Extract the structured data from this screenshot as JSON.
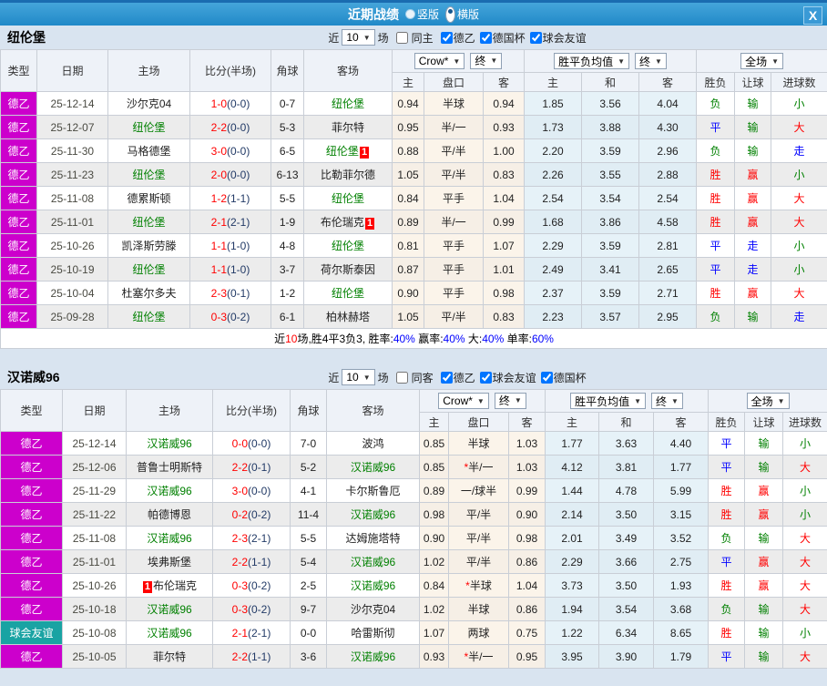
{
  "titlebar": {
    "title": "近期战绩",
    "radios": [
      {
        "label": "竖版",
        "selected": false
      },
      {
        "label": "横版",
        "selected": true
      }
    ],
    "close_label": "X"
  },
  "result_colors": {
    "胜": "r",
    "赢": "r",
    "大": "r",
    "平": "b",
    "走": "b",
    "负": "g",
    "输": "g",
    "小": "g"
  },
  "palette": {
    "league_badge_bg": "#cc00cc",
    "friendly_badge_bg": "#19a3a3",
    "team_highlight": "#008000",
    "score": "#ff0000",
    "win_red": "#ff0000",
    "draw_blue": "#0000ff",
    "lose_green": "#008000"
  },
  "tables": [
    {
      "team": "纽伦堡",
      "filter": {
        "near": "近",
        "count": "10",
        "unit": "场",
        "same": {
          "label": "同主",
          "checked": false
        },
        "leagues": [
          {
            "label": "德乙",
            "checked": true
          },
          {
            "label": "德国杯",
            "checked": true
          },
          {
            "label": "球会友谊",
            "checked": true
          }
        ]
      },
      "columns": {
        "type": "类型",
        "date": "日期",
        "home": "主场",
        "score": "比分(半场)",
        "corner": "角球",
        "away": "客场"
      },
      "selects": {
        "company": "Crow*",
        "final1": "终",
        "avg": "胜平负均值",
        "final2": "终",
        "scope": "全场"
      },
      "subheaders": [
        "主",
        "盘口",
        "客",
        "主",
        "和",
        "客",
        "胜负",
        "让球",
        "进球数"
      ],
      "rows": [
        {
          "type": "德乙",
          "tkey": "league",
          "date": "25-12-14",
          "home": {
            "name": "沙尔克04",
            "green": false
          },
          "score": "1-0",
          "half": "(0-0)",
          "corner": "0-7",
          "away": {
            "name": "纽伦堡",
            "green": true
          },
          "odds": [
            "0.94",
            "半球",
            "0.94",
            "1.85",
            "3.56",
            "4.04"
          ],
          "res": [
            "负",
            "输",
            "小"
          ]
        },
        {
          "type": "德乙",
          "tkey": "league",
          "date": "25-12-07",
          "home": {
            "name": "纽伦堡",
            "green": true
          },
          "score": "2-2",
          "half": "(0-0)",
          "corner": "5-3",
          "away": {
            "name": "菲尔特",
            "green": false
          },
          "odds": [
            "0.95",
            "半/一",
            "0.93",
            "1.73",
            "3.88",
            "4.30"
          ],
          "res": [
            "平",
            "输",
            "大"
          ]
        },
        {
          "type": "德乙",
          "tkey": "league",
          "date": "25-11-30",
          "home": {
            "name": "马格德堡",
            "green": false
          },
          "score": "3-0",
          "half": "(0-0)",
          "corner": "6-5",
          "away": {
            "name": "纽伦堡",
            "green": true,
            "badge": "1",
            "badge_side": "right"
          },
          "odds": [
            "0.88",
            "平/半",
            "1.00",
            "2.20",
            "3.59",
            "2.96"
          ],
          "res": [
            "负",
            "输",
            "走"
          ]
        },
        {
          "type": "德乙",
          "tkey": "league",
          "date": "25-11-23",
          "home": {
            "name": "纽伦堡",
            "green": true
          },
          "score": "2-0",
          "half": "(0-0)",
          "corner": "6-13",
          "away": {
            "name": "比勒菲尔德",
            "green": false
          },
          "odds": [
            "1.05",
            "平/半",
            "0.83",
            "2.26",
            "3.55",
            "2.88"
          ],
          "res": [
            "胜",
            "赢",
            "小"
          ]
        },
        {
          "type": "德乙",
          "tkey": "league",
          "date": "25-11-08",
          "home": {
            "name": "德累斯顿",
            "green": false
          },
          "score": "1-2",
          "half": "(1-1)",
          "corner": "5-5",
          "away": {
            "name": "纽伦堡",
            "green": true
          },
          "odds": [
            "0.84",
            "平手",
            "1.04",
            "2.54",
            "3.54",
            "2.54"
          ],
          "res": [
            "胜",
            "赢",
            "大"
          ]
        },
        {
          "type": "德乙",
          "tkey": "league",
          "date": "25-11-01",
          "home": {
            "name": "纽伦堡",
            "green": true
          },
          "score": "2-1",
          "half": "(2-1)",
          "corner": "1-9",
          "away": {
            "name": "布伦瑞克",
            "green": false,
            "badge": "1",
            "badge_side": "right"
          },
          "odds": [
            "0.89",
            "半/一",
            "0.99",
            "1.68",
            "3.86",
            "4.58"
          ],
          "res": [
            "胜",
            "赢",
            "大"
          ]
        },
        {
          "type": "德乙",
          "tkey": "league",
          "date": "25-10-26",
          "home": {
            "name": "凯泽斯劳滕",
            "green": false
          },
          "score": "1-1",
          "half": "(1-0)",
          "corner": "4-8",
          "away": {
            "name": "纽伦堡",
            "green": true
          },
          "odds": [
            "0.81",
            "平手",
            "1.07",
            "2.29",
            "3.59",
            "2.81"
          ],
          "res": [
            "平",
            "走",
            "小"
          ]
        },
        {
          "type": "德乙",
          "tkey": "league",
          "date": "25-10-19",
          "home": {
            "name": "纽伦堡",
            "green": true
          },
          "score": "1-1",
          "half": "(1-0)",
          "corner": "3-7",
          "away": {
            "name": "荷尔斯泰因",
            "green": false
          },
          "odds": [
            "0.87",
            "平手",
            "1.01",
            "2.49",
            "3.41",
            "2.65"
          ],
          "res": [
            "平",
            "走",
            "小"
          ]
        },
        {
          "type": "德乙",
          "tkey": "league",
          "date": "25-10-04",
          "home": {
            "name": "杜塞尔多夫",
            "green": false
          },
          "score": "2-3",
          "half": "(0-1)",
          "corner": "1-2",
          "away": {
            "name": "纽伦堡",
            "green": true
          },
          "odds": [
            "0.90",
            "平手",
            "0.98",
            "2.37",
            "3.59",
            "2.71"
          ],
          "res": [
            "胜",
            "赢",
            "大"
          ]
        },
        {
          "type": "德乙",
          "tkey": "league",
          "date": "25-09-28",
          "home": {
            "name": "纽伦堡",
            "green": true
          },
          "score": "0-3",
          "half": "(0-2)",
          "corner": "6-1",
          "away": {
            "name": "柏林赫塔",
            "green": false
          },
          "odds": [
            "1.05",
            "平/半",
            "0.83",
            "2.23",
            "3.57",
            "2.95"
          ],
          "res": [
            "负",
            "输",
            "走"
          ]
        }
      ],
      "summary": [
        {
          "t": "近",
          "c": "k"
        },
        {
          "t": "10",
          "c": "r"
        },
        {
          "t": "场,胜4平3负3, 胜率:",
          "c": "k"
        },
        {
          "t": "40%",
          "c": "b"
        },
        {
          "t": " 赢率:",
          "c": "k"
        },
        {
          "t": "40%",
          "c": "b"
        },
        {
          "t": " 大:",
          "c": "k"
        },
        {
          "t": "40%",
          "c": "b"
        },
        {
          "t": " 单率:",
          "c": "k"
        },
        {
          "t": "60%",
          "c": "b"
        }
      ]
    },
    {
      "team": "汉诺威96",
      "filter": {
        "near": "近",
        "count": "10",
        "unit": "场",
        "same": {
          "label": "同客",
          "checked": false
        },
        "leagues": [
          {
            "label": "德乙",
            "checked": true
          },
          {
            "label": "球会友谊",
            "checked": true
          },
          {
            "label": "德国杯",
            "checked": true
          }
        ]
      },
      "columns": {
        "type": "类型",
        "date": "日期",
        "home": "主场",
        "score": "比分(半场)",
        "corner": "角球",
        "away": "客场"
      },
      "selects": {
        "company": "Crow*",
        "final1": "终",
        "avg": "胜平负均值",
        "final2": "终",
        "scope": "全场"
      },
      "subheaders": [
        "主",
        "盘口",
        "客",
        "主",
        "和",
        "客",
        "胜负",
        "让球",
        "进球数"
      ],
      "rows": [
        {
          "type": "德乙",
          "tkey": "league",
          "date": "25-12-14",
          "home": {
            "name": "汉诺威96",
            "green": true
          },
          "score": "0-0",
          "half": "(0-0)",
          "corner": "7-0",
          "away": {
            "name": "波鸿",
            "green": false
          },
          "odds": [
            "0.85",
            "半球",
            "1.03",
            "1.77",
            "3.63",
            "4.40"
          ],
          "res": [
            "平",
            "输",
            "小"
          ]
        },
        {
          "type": "德乙",
          "tkey": "league",
          "date": "25-12-06",
          "home": {
            "name": "普鲁士明斯特",
            "green": false
          },
          "score": "2-2",
          "half": "(0-1)",
          "corner": "5-2",
          "away": {
            "name": "汉诺威96",
            "green": true
          },
          "odds": [
            "0.85",
            "*半/一",
            "1.03",
            "4.12",
            "3.81",
            "1.77"
          ],
          "res": [
            "平",
            "输",
            "大"
          ]
        },
        {
          "type": "德乙",
          "tkey": "league",
          "date": "25-11-29",
          "home": {
            "name": "汉诺威96",
            "green": true
          },
          "score": "3-0",
          "half": "(0-0)",
          "corner": "4-1",
          "away": {
            "name": "卡尔斯鲁厄",
            "green": false
          },
          "odds": [
            "0.89",
            "一/球半",
            "0.99",
            "1.44",
            "4.78",
            "5.99"
          ],
          "res": [
            "胜",
            "赢",
            "小"
          ]
        },
        {
          "type": "德乙",
          "tkey": "league",
          "date": "25-11-22",
          "home": {
            "name": "帕德博恩",
            "green": false
          },
          "score": "0-2",
          "half": "(0-2)",
          "corner": "11-4",
          "away": {
            "name": "汉诺威96",
            "green": true
          },
          "odds": [
            "0.98",
            "平/半",
            "0.90",
            "2.14",
            "3.50",
            "3.15"
          ],
          "res": [
            "胜",
            "赢",
            "小"
          ]
        },
        {
          "type": "德乙",
          "tkey": "league",
          "date": "25-11-08",
          "home": {
            "name": "汉诺威96",
            "green": true
          },
          "score": "2-3",
          "half": "(2-1)",
          "corner": "5-5",
          "away": {
            "name": "达姆施塔特",
            "green": false
          },
          "odds": [
            "0.90",
            "平/半",
            "0.98",
            "2.01",
            "3.49",
            "3.52"
          ],
          "res": [
            "负",
            "输",
            "大"
          ]
        },
        {
          "type": "德乙",
          "tkey": "league",
          "date": "25-11-01",
          "home": {
            "name": "埃弗斯堡",
            "green": false
          },
          "score": "2-2",
          "half": "(1-1)",
          "corner": "5-4",
          "away": {
            "name": "汉诺威96",
            "green": true
          },
          "odds": [
            "1.02",
            "平/半",
            "0.86",
            "2.29",
            "3.66",
            "2.75"
          ],
          "res": [
            "平",
            "赢",
            "大"
          ]
        },
        {
          "type": "德乙",
          "tkey": "league",
          "date": "25-10-26",
          "home": {
            "name": "布伦瑞克",
            "green": false,
            "badge": "1",
            "badge_side": "left"
          },
          "score": "0-3",
          "half": "(0-2)",
          "corner": "2-5",
          "away": {
            "name": "汉诺威96",
            "green": true
          },
          "odds": [
            "0.84",
            "*半球",
            "1.04",
            "3.73",
            "3.50",
            "1.93"
          ],
          "res": [
            "胜",
            "赢",
            "大"
          ]
        },
        {
          "type": "德乙",
          "tkey": "league",
          "date": "25-10-18",
          "home": {
            "name": "汉诺威96",
            "green": true
          },
          "score": "0-3",
          "half": "(0-2)",
          "corner": "9-7",
          "away": {
            "name": "沙尔克04",
            "green": false
          },
          "odds": [
            "1.02",
            "半球",
            "0.86",
            "1.94",
            "3.54",
            "3.68"
          ],
          "res": [
            "负",
            "输",
            "大"
          ]
        },
        {
          "type": "球会友谊",
          "tkey": "friendly",
          "date": "25-10-08",
          "home": {
            "name": "汉诺威96",
            "green": true
          },
          "score": "2-1",
          "half": "(2-1)",
          "corner": "0-0",
          "away": {
            "name": "哈雷斯彻",
            "green": false
          },
          "odds": [
            "1.07",
            "两球",
            "0.75",
            "1.22",
            "6.34",
            "8.65"
          ],
          "res": [
            "胜",
            "输",
            "小"
          ]
        },
        {
          "type": "德乙",
          "tkey": "league",
          "date": "25-10-05",
          "home": {
            "name": "菲尔特",
            "green": false
          },
          "score": "2-2",
          "half": "(1-1)",
          "corner": "3-6",
          "away": {
            "name": "汉诺威96",
            "green": true
          },
          "odds": [
            "0.93",
            "*半/一",
            "0.95",
            "3.95",
            "3.90",
            "1.79"
          ],
          "res": [
            "平",
            "输",
            "大"
          ]
        }
      ]
    }
  ]
}
